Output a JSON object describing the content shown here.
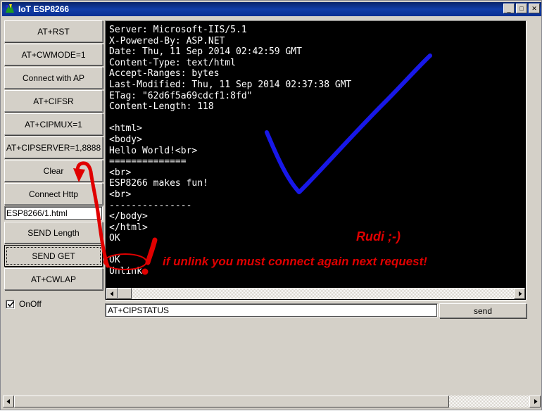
{
  "window": {
    "title": "IoT ESP8266",
    "icon": "app-icon",
    "buttons": {
      "minimize": "_",
      "maximize": "□",
      "close": "✕"
    }
  },
  "sidebar": {
    "buttons": [
      {
        "label": "AT+RST",
        "name": "at-rst-button"
      },
      {
        "label": "AT+CWMODE=1",
        "name": "at-cwmode-button"
      },
      {
        "label": "Connect with AP",
        "name": "connect-with-ap-button"
      },
      {
        "label": "AT+CIFSR",
        "name": "at-cifsr-button"
      },
      {
        "label": "AT+CIPMUX=1",
        "name": "at-cipmux-button"
      },
      {
        "label": "AT+CIPSERVER=1,8888",
        "name": "at-cipserver-button"
      },
      {
        "label": "Clear",
        "name": "clear-button"
      },
      {
        "label": "Connect Http",
        "name": "connect-http-button"
      }
    ],
    "url_field": {
      "value": "ESP8266/1.html",
      "name": "url-input"
    },
    "buttons_lower": [
      {
        "label": "SEND Length",
        "name": "send-length-button",
        "focused": false
      },
      {
        "label": "SEND GET",
        "name": "send-get-button",
        "focused": true
      },
      {
        "label": "AT+CWLAP",
        "name": "at-cwlap-button",
        "focused": false
      }
    ],
    "checkbox": {
      "label": "OnOff",
      "checked": true
    }
  },
  "terminal": {
    "lines": [
      "Server: Microsoft-IIS/5.1",
      "X-Powered-By: ASP.NET",
      "Date: Thu, 11 Sep 2014 02:42:59 GMT",
      "Content-Type: text/html",
      "Accept-Ranges: bytes",
      "Last-Modified: Thu, 11 Sep 2014 02:37:38 GMT",
      "ETag: \"62d6f5a69cdcf1:8fd\"",
      "Content-Length: 118",
      "",
      "<html>",
      "<body>",
      "Hello World!<br>",
      "==============",
      "<br>",
      "ESP8266 makes fun!",
      "<br>",
      "---------------",
      "</body>",
      "</html>",
      "OK",
      "",
      "OK",
      "Unlink"
    ]
  },
  "command_bar": {
    "input_value": "AT+CIPSTATUS",
    "send_label": "send"
  },
  "annotations": {
    "main_note": "if unlink you must connect again next request!",
    "signature": "Rudi ;-)",
    "colors": {
      "annotation_red": "#e00000",
      "curve_blue": "#1818e8"
    }
  },
  "scrollbars": {
    "left_arrow": "◄",
    "right_arrow": "►"
  }
}
